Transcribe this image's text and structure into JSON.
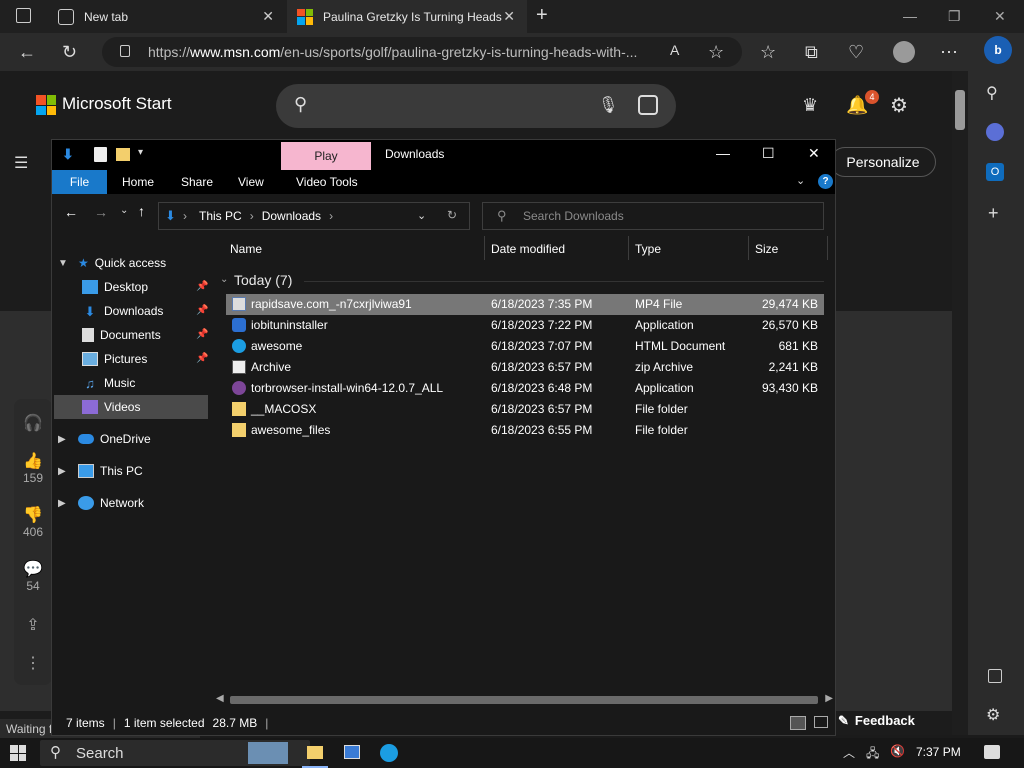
{
  "browser": {
    "tabs": [
      {
        "title": "New tab",
        "active": false
      },
      {
        "title": "Paulina Gretzky Is Turning Heads",
        "active": true
      }
    ],
    "url_prefix": "https://",
    "url_domain": "www.msn.com",
    "url_path": "/en-us/sports/golf/paulina-gretzky-is-turning-heads-with-...",
    "status_text": "Waiting for"
  },
  "msn": {
    "brand": "Microsoft Start",
    "notification_count": "4",
    "personalize_label": "Personalize",
    "social": {
      "likes": "159",
      "dislikes": "406",
      "comments": "54"
    },
    "feedback_label": "Feedback"
  },
  "explorer": {
    "title": "Downloads",
    "contextual_tab": "Play",
    "ribbon_tabs": {
      "file": "File",
      "home": "Home",
      "share": "Share",
      "view": "View",
      "video_tools": "Video Tools"
    },
    "breadcrumb": [
      "This PC",
      "Downloads"
    ],
    "search_placeholder": "Search Downloads",
    "nav": {
      "quick_access": "Quick access",
      "desktop": "Desktop",
      "downloads": "Downloads",
      "documents": "Documents",
      "pictures": "Pictures",
      "music": "Music",
      "videos": "Videos",
      "onedrive": "OneDrive",
      "this_pc": "This PC",
      "network": "Network"
    },
    "columns": {
      "name": "Name",
      "date": "Date modified",
      "type": "Type",
      "size": "Size"
    },
    "group_label": "Today (7)",
    "files": [
      {
        "name": "rapidsave.com_-n7cxrjlviwa91",
        "date": "6/18/2023 7:35 PM",
        "type": "MP4 File",
        "size": "29,474 KB",
        "icon": "video-file-icon",
        "selected": true
      },
      {
        "name": "iobituninstaller",
        "date": "6/18/2023 7:22 PM",
        "type": "Application",
        "size": "26,570 KB",
        "icon": "installer-icon",
        "selected": false
      },
      {
        "name": "awesome",
        "date": "6/18/2023 7:07 PM",
        "type": "HTML Document",
        "size": "681 KB",
        "icon": "edge-html-icon",
        "selected": false
      },
      {
        "name": "Archive",
        "date": "6/18/2023 6:57 PM",
        "type": "zip Archive",
        "size": "2,241 KB",
        "icon": "zip-icon",
        "selected": false
      },
      {
        "name": "torbrowser-install-win64-12.0.7_ALL",
        "date": "6/18/2023 6:48 PM",
        "type": "Application",
        "size": "93,430 KB",
        "icon": "tor-icon",
        "selected": false
      },
      {
        "name": "__MACOSX",
        "date": "6/18/2023 6:57 PM",
        "type": "File folder",
        "size": "",
        "icon": "folder-icon",
        "selected": false
      },
      {
        "name": "awesome_files",
        "date": "6/18/2023 6:55 PM",
        "type": "File folder",
        "size": "",
        "icon": "folder-icon",
        "selected": false
      }
    ],
    "status": {
      "count": "7 items",
      "selection": "1 item selected",
      "size": "28.7 MB"
    }
  },
  "taskbar": {
    "search_label": "Search",
    "time": "7:37 PM"
  }
}
